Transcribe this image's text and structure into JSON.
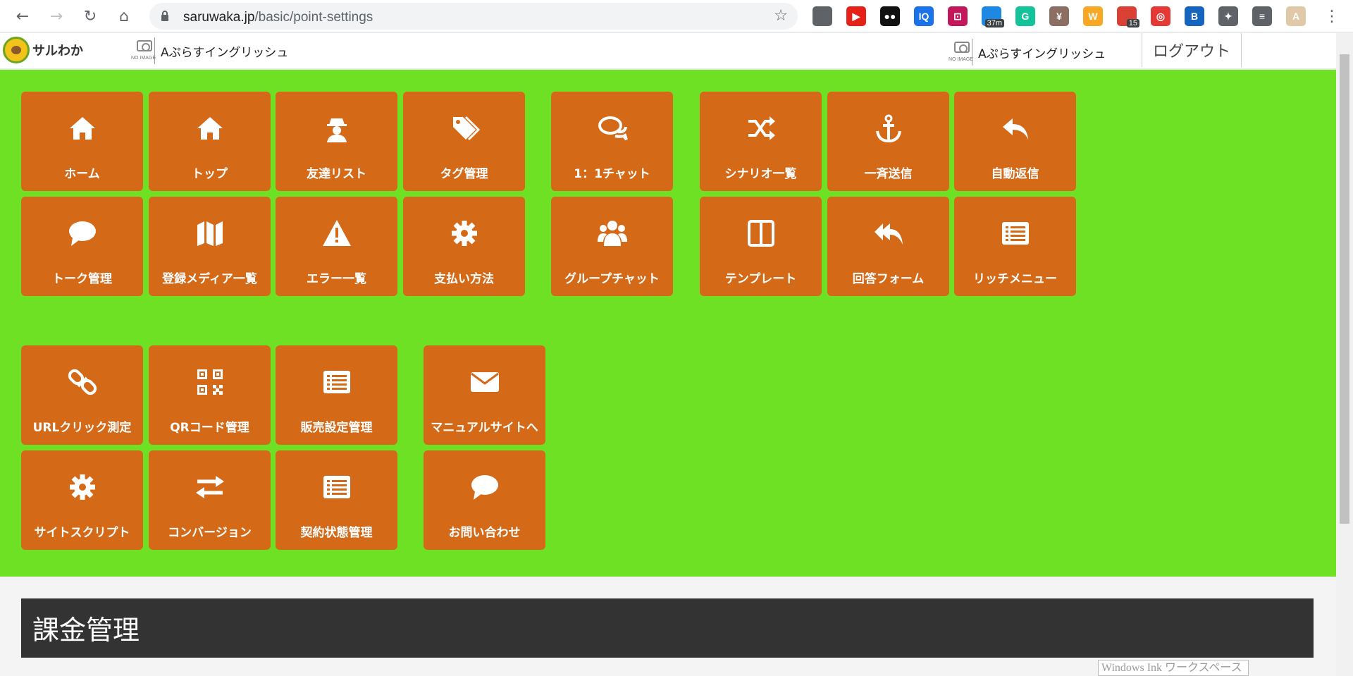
{
  "browser": {
    "url_host": "saruwaka.jp",
    "url_path": "/basic/point-settings",
    "extensions": [
      {
        "icon": "camera-ext-icon",
        "text": "",
        "color": "#5f6368"
      },
      {
        "icon": "youtube-ext-icon",
        "text": "▶",
        "color": "#e62117"
      },
      {
        "icon": "mask-ext-icon",
        "text": "●●",
        "color": "#111111"
      },
      {
        "icon": "iq-ext-icon",
        "text": "IQ",
        "color": "#1a73e8"
      },
      {
        "icon": "clipper-ext-icon",
        "text": "⊡",
        "color": "#c2185b"
      },
      {
        "icon": "timer-ext-icon",
        "text": "",
        "color": "#1e88e5",
        "badge": "37m"
      },
      {
        "icon": "grammarly-ext-icon",
        "text": "G",
        "color": "#15c39a"
      },
      {
        "icon": "yen-ext-icon",
        "text": "¥",
        "color": "#8d6e63"
      },
      {
        "icon": "w-ext-icon",
        "text": "W",
        "color": "#f9a825"
      },
      {
        "icon": "todo-ext-icon",
        "text": "",
        "color": "#db4035",
        "badge": "15"
      },
      {
        "icon": "spiral-ext-icon",
        "text": "◎",
        "color": "#e53935"
      },
      {
        "icon": "b-ext-icon",
        "text": "B",
        "color": "#1565c0"
      },
      {
        "icon": "puzzle-ext-icon",
        "text": "✦",
        "color": "#5f6368"
      },
      {
        "icon": "queue-ext-icon",
        "text": "≡",
        "color": "#5f6368"
      },
      {
        "icon": "profile-ext-icon",
        "text": "A",
        "color": "#e0c9a6"
      }
    ]
  },
  "header": {
    "logo_text": "サルわか",
    "noimage_caption": "NO IMAGE",
    "account_left": "Aぷらすイングリッシュ",
    "account_right": "Aぷらすイングリッシュ",
    "logout_label": "ログアウト"
  },
  "menu": [
    {
      "label": "ホーム",
      "icon": "home"
    },
    {
      "label": "トップ",
      "icon": "home"
    },
    {
      "label": "友達リスト",
      "icon": "user-secret"
    },
    {
      "label": "タグ管理",
      "icon": "tags"
    },
    {
      "label": "1：1チャット",
      "icon": "comments"
    },
    {
      "label": "シナリオ一覧",
      "icon": "random"
    },
    {
      "label": "一斉送信",
      "icon": "anchor"
    },
    {
      "label": "自動返信",
      "icon": "reply"
    },
    {
      "label": "トーク管理",
      "icon": "comment"
    },
    {
      "label": "登録メディア一覧",
      "icon": "map"
    },
    {
      "label": "エラー一覧",
      "icon": "warning"
    },
    {
      "label": "支払い方法",
      "icon": "cog"
    },
    {
      "label": "グループチャット",
      "icon": "users"
    },
    {
      "label": "テンプレート",
      "icon": "columns"
    },
    {
      "label": "回答フォーム",
      "icon": "reply-all"
    },
    {
      "label": "リッチメニュー",
      "icon": "list-alt"
    },
    {
      "label": "URLクリック測定",
      "icon": "link"
    },
    {
      "label": "QRコード管理",
      "icon": "qrcode"
    },
    {
      "label": "販売設定管理",
      "icon": "list-alt"
    },
    {
      "label": "マニュアルサイトへ",
      "icon": "envelope"
    },
    {
      "label": "サイトスクリプト",
      "icon": "cog"
    },
    {
      "label": "コンバージョン",
      "icon": "exchange"
    },
    {
      "label": "契約状態管理",
      "icon": "list-alt"
    },
    {
      "label": "お問い合わせ",
      "icon": "comment"
    }
  ],
  "section_title": "課金管理",
  "ink_tooltip": "Windows Ink ワークスペース"
}
